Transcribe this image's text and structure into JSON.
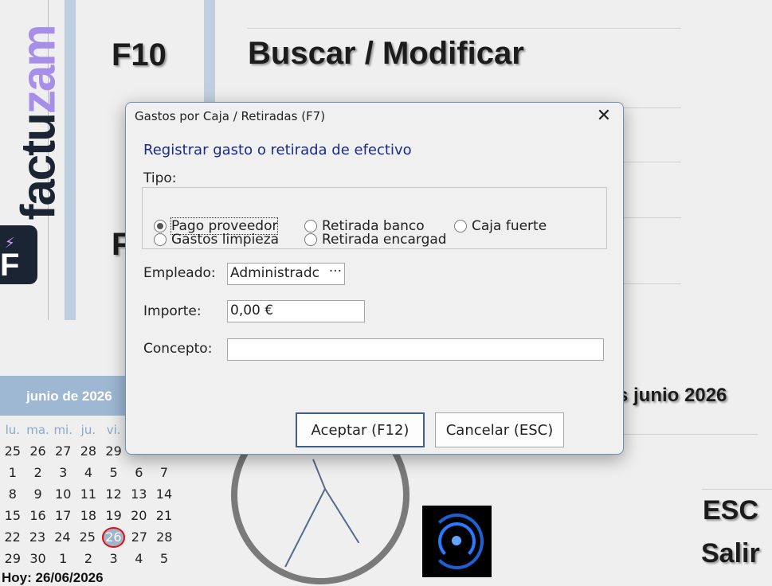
{
  "background": {
    "logo": {
      "text_main": "factu",
      "text_accent": "zam",
      "badge_letter": "F"
    },
    "function_keys": [
      {
        "key": "F10",
        "label": "Buscar / Modificar"
      }
    ],
    "partial_key": "F",
    "calendar": {
      "month_title": "junio de 2026",
      "weekdays": [
        "lu.",
        "ma.",
        "mi.",
        "ju.",
        "vi.",
        "",
        ""
      ],
      "weeks": [
        [
          "25",
          "26",
          "27",
          "28",
          "29",
          "",
          ""
        ],
        [
          "1",
          "2",
          "3",
          "4",
          "5",
          "6",
          "7"
        ],
        [
          "8",
          "9",
          "10",
          "11",
          "12",
          "13",
          "14"
        ],
        [
          "15",
          "16",
          "17",
          "18",
          "19",
          "20",
          "21"
        ],
        [
          "22",
          "23",
          "24",
          "25",
          "26",
          "27",
          "28"
        ],
        [
          "29",
          "30",
          "1",
          "2",
          "3",
          "4",
          "5"
        ]
      ],
      "today_day": "26",
      "today_text": "Hoy: 26/06/2026"
    },
    "date_text": "s junio 2026",
    "esc_key": "ESC",
    "esc_label": "Salir"
  },
  "dialog": {
    "title": "Gastos por Caja / Retiradas (F7)",
    "heading": "Registrar gasto o retirada de efectivo",
    "tipo_label": "Tipo:",
    "tipo_options": [
      {
        "label": "Pago proveedor",
        "selected": true
      },
      {
        "label": "Retirada banco",
        "selected": false
      },
      {
        "label": "Caja fuerte",
        "selected": false
      },
      {
        "label": "Gastos limpieza",
        "selected": false
      },
      {
        "label": "Retirada encargad",
        "selected": false
      }
    ],
    "empleado_label": "Empleado:",
    "empleado_value": "Administradc",
    "importe_label": "Importe:",
    "importe_value": "0,00 €",
    "concepto_label": "Concepto:",
    "concepto_value": "",
    "accept_label": "Aceptar (F12)",
    "cancel_label": "Cancelar (ESC)",
    "close_glyph": "✕",
    "colors": {
      "heading": "#1a2a8a",
      "dialog_border": "#6f8fb3",
      "calendar_header": "#9eb8d4"
    }
  }
}
